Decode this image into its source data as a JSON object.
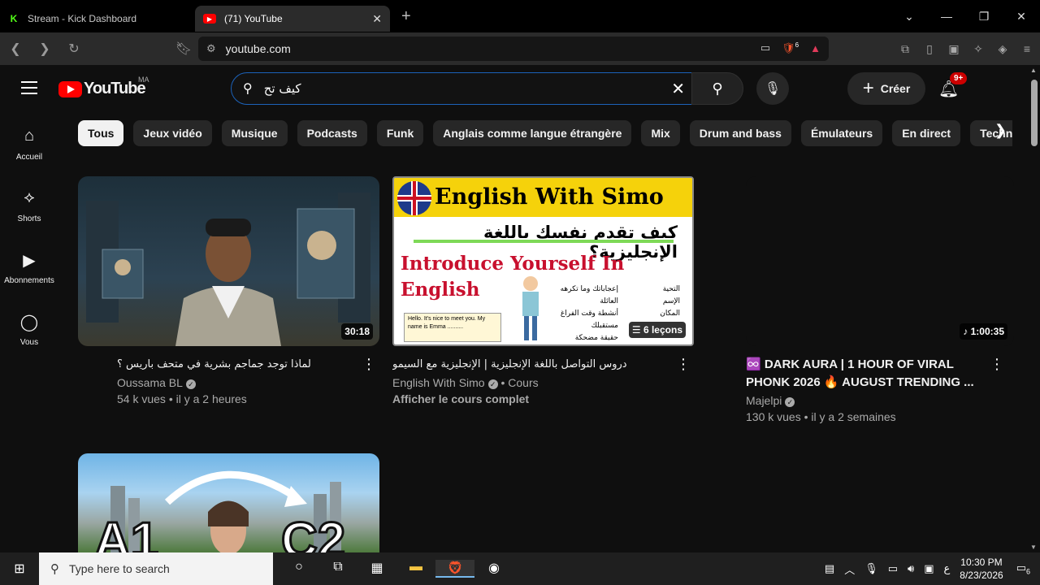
{
  "browser": {
    "tabs": [
      {
        "title": "Stream - Kick Dashboard",
        "icon": "K",
        "active": false
      },
      {
        "title": "(71) YouTube",
        "icon": "▶",
        "active": true
      }
    ],
    "url": "youtube.com",
    "shields_count": "6"
  },
  "header": {
    "logo_word": "YouTube",
    "country_code": "MA",
    "search_value": "كيف تح",
    "create_label": "Créer",
    "notif_badge": "9+"
  },
  "sidebar": {
    "items": [
      {
        "label": "Accueil",
        "icon": "home-icon"
      },
      {
        "label": "Shorts",
        "icon": "shorts-icon"
      },
      {
        "label": "Abonnements",
        "icon": "subscriptions-icon"
      },
      {
        "label": "Vous",
        "icon": "you-icon"
      }
    ]
  },
  "chips": [
    "Tous",
    "Jeux vidéo",
    "Musique",
    "Podcasts",
    "Funk",
    "Anglais comme langue étrangère",
    "Mix",
    "Drum and bass",
    "Émulateurs",
    "En direct",
    "Techno"
  ],
  "videos": [
    {
      "title": "لماذا توجد جماجم بشرية في متحف باريس ؟",
      "channel": "Oussama BL",
      "stats": "54 k vues • il y a 2 heures",
      "duration": "30:18"
    },
    {
      "title": "دروس التواصل باللغة الإنجليزية | الإنجليزية مع السيمو",
      "channel": "English With Simo",
      "channel_suffix": "• Cours",
      "link": "Afficher le cours complet",
      "duration": "6 leçons",
      "thumb_heading": "English With Simo",
      "thumb_arabic": "كيف تقدم نفسك باللغة الإنجليزية؟",
      "thumb_sub1": "Introduce Yourself In",
      "thumb_sub2": "English",
      "thumb_bubble": "Hello. It's nice to meet you. My name is Emma ..........",
      "thumb_list_left": [
        "إعجاباتك وما تكرهه",
        "العائلة",
        "أنشطة وقت الفراغ",
        "مستقبلك",
        "حقيقة مضحكة"
      ],
      "thumb_list_right": [
        "التحية",
        "الإسم",
        "المكان"
      ]
    },
    {
      "title": "♾️ DARK AURA | 1 HOUR OF VIRAL PHONK 2026 🔥 AUGUST TRENDING ...",
      "channel": "Majelpi",
      "stats": "130 k vues • il y a 2 semaines",
      "duration": "1:00:35"
    },
    {
      "thumb_left": "A1",
      "thumb_right": "C2"
    }
  ],
  "taskbar": {
    "search_placeholder": "Type here to search",
    "time": "10:30 PM",
    "date": "8/23/2026",
    "lang": "ع",
    "notif_count": "6"
  }
}
